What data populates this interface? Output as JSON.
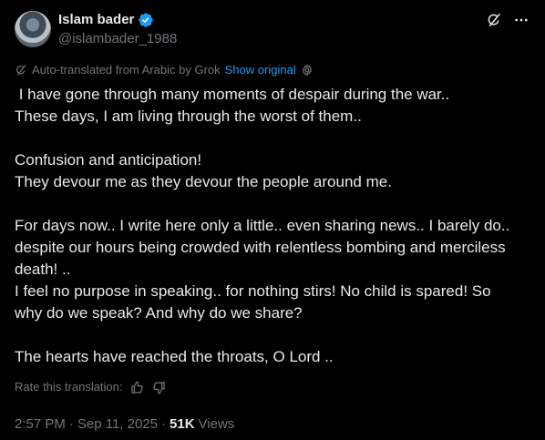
{
  "author": {
    "display_name": "Islam bader",
    "handle": "@islambader_1988"
  },
  "translation": {
    "notice": "Auto-translated from Arabic by Grok",
    "show_original": "Show original"
  },
  "tweet": {
    "paragraphs": [
      [
        " I have gone through many moments of despair during the war..",
        "These days, I am living through the worst of them.."
      ],
      [
        "Confusion and anticipation!",
        "They devour me as they devour the people around me."
      ],
      [
        "For days now.. I write here only a little.. even sharing news.. I barely do..",
        "despite our hours being crowded with relentless bombing and merciless",
        "death! ..",
        "I feel no purpose in speaking.. for nothing stirs! No child is spared! So",
        "why do we speak? And why do we share?"
      ],
      [
        "The hearts have reached the throats, O Lord .."
      ]
    ]
  },
  "rate": {
    "label": "Rate this translation:"
  },
  "meta": {
    "time": "2:57 PM",
    "separator": "·",
    "date": "Sep 11, 2025",
    "views_count": "51K",
    "views_label": "Views"
  },
  "colors": {
    "background": "#000000",
    "text": "#e7e9ea",
    "secondary": "#71767b",
    "accent": "#1d9bf0"
  },
  "icons": {
    "verified": "verified-badge-icon",
    "grok": "grok-icon",
    "more": "more-icon",
    "translate": "grok-translate-icon",
    "settings": "settings-icon",
    "thumbs_up": "thumbs-up-icon",
    "thumbs_down": "thumbs-down-icon"
  }
}
